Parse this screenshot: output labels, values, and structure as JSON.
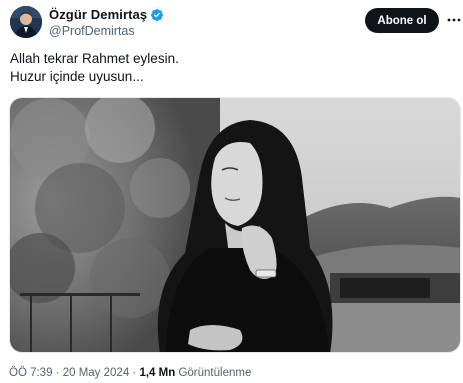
{
  "author": {
    "display_name": "Özgür Demirtaş",
    "handle": "@ProfDemirtas",
    "verified": true,
    "avatar_icon": "profile-avatar",
    "verified_icon": "verified-badge-icon",
    "verified_color": "#1d9bf0"
  },
  "actions": {
    "follow_label": "Abone ol",
    "more_icon": "more-options-icon"
  },
  "tweet": {
    "lines": [
      "Allah tekrar Rahmet eylesin.",
      "Huzur içinde uyusun..."
    ]
  },
  "media": {
    "type": "photo",
    "style": "black-and-white"
  },
  "meta": {
    "time": "ÖÖ 7:39",
    "date": "20 May 2024",
    "separator": "·",
    "views_count": "1,4 Mn",
    "views_label": "Görüntülenme"
  }
}
